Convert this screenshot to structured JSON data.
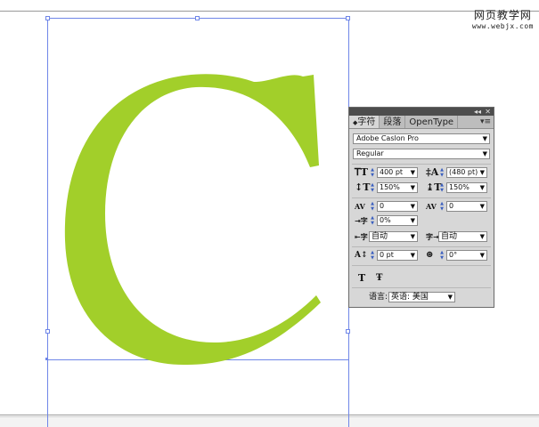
{
  "watermark": {
    "title": "网页教学网",
    "url": "www.webjx.com"
  },
  "canvas": {
    "letter": "C",
    "letter_color": "#a2cf2a",
    "frame_color": "#6f86e8"
  },
  "panel": {
    "tabs": [
      "字符",
      "段落",
      "OpenType"
    ],
    "font_family": "Adobe Caslon Pro",
    "font_style": "Regular",
    "font_size": "400 pt",
    "leading": "(480 pt)",
    "vertical_scale": "150%",
    "horizontal_scale": "150%",
    "kerning": "0",
    "tracking": "0",
    "tsume": "0%",
    "aki_left": "自动",
    "aki_right": "自动",
    "baseline_shift": "0 pt",
    "rotation": "0°",
    "language_label": "语言:",
    "language_value": "英语: 美国"
  },
  "icons": {
    "font_size": "size-T-icon",
    "leading": "leading-icon",
    "vscale": "vertical-scale-icon",
    "hscale": "horizontal-scale-icon",
    "kerning": "kerning-icon",
    "tracking": "tracking-icon",
    "tsume": "tsume-icon",
    "aki_left": "aki-left-icon",
    "aki_right": "aki-right-icon",
    "baseline": "baseline-shift-icon",
    "rotation": "rotation-icon"
  }
}
